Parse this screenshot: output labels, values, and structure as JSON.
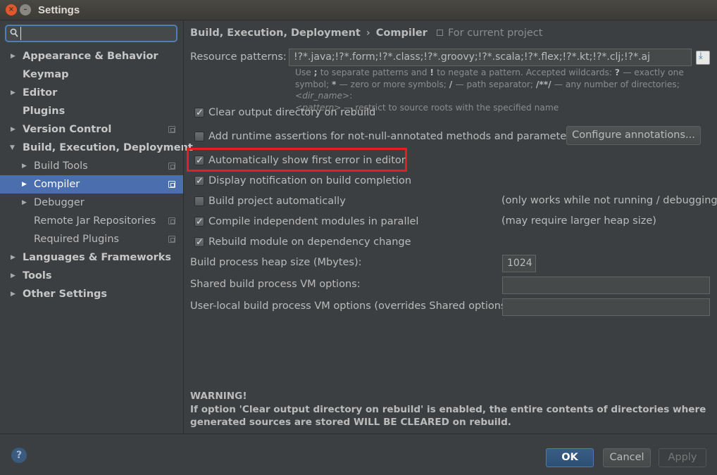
{
  "window": {
    "title": "Settings"
  },
  "search": {
    "value": "",
    "placeholder": ""
  },
  "sidebar": {
    "items": [
      {
        "label": "Appearance & Behavior",
        "arrow": "▶",
        "bold": true
      },
      {
        "label": "Keymap",
        "arrow": "",
        "bold": true
      },
      {
        "label": "Editor",
        "arrow": "▶",
        "bold": true
      },
      {
        "label": "Plugins",
        "arrow": "",
        "bold": true
      },
      {
        "label": "Version Control",
        "arrow": "▶",
        "bold": true
      },
      {
        "label": "Build, Execution, Deployment",
        "arrow": "▼",
        "bold": true
      },
      {
        "label": "Build Tools",
        "arrow": "▶",
        "bold": false
      },
      {
        "label": "Compiler",
        "arrow": "▶",
        "bold": false,
        "selected": true
      },
      {
        "label": "Debugger",
        "arrow": "▶",
        "bold": false
      },
      {
        "label": "Remote Jar Repositories",
        "arrow": "",
        "bold": false
      },
      {
        "label": "Required Plugins",
        "arrow": "",
        "bold": false
      },
      {
        "label": "Languages & Frameworks",
        "arrow": "▶",
        "bold": true
      },
      {
        "label": "Tools",
        "arrow": "▶",
        "bold": true
      },
      {
        "label": "Other Settings",
        "arrow": "▶",
        "bold": true
      }
    ]
  },
  "breadcrumb": {
    "parent": "Build, Execution, Deployment",
    "separator": "›",
    "current": "Compiler",
    "scope": "For current project"
  },
  "resource_patterns": {
    "label": "Resource patterns:",
    "value": "!?*.java;!?*.form;!?*.class;!?*.groovy;!?*.scala;!?*.flex;!?*.kt;!?*.clj;!?*.aj"
  },
  "hint": {
    "p1": "Use ",
    "p2": "; ",
    "p3": "to separate patterns and ",
    "p4": "! ",
    "p5": "to negate a pattern. Accepted wildcards: ",
    "p6": "? ",
    "p7": "— exactly one symbol; ",
    "p8": "* ",
    "p9": "— zero or more symbols; ",
    "p10": "/ ",
    "p11": "— path separator; ",
    "p12": "/**/ ",
    "p13": "— any number of directories; ",
    "p14": "<dir_name>",
    "p15": ":",
    "p16": "<pattern>",
    "p17": " — restrict to source roots with the specified name"
  },
  "checkboxes": [
    {
      "label": "Clear output directory on rebuild",
      "checked": true
    },
    {
      "label": "Add runtime assertions for not-null-annotated methods and parameters",
      "checked": false
    },
    {
      "label": "Automatically show first error in editor",
      "checked": true
    },
    {
      "label": "Display notification on build completion",
      "checked": true
    },
    {
      "label": "Build project automatically",
      "checked": false
    },
    {
      "label": "Compile independent modules in parallel",
      "checked": true
    },
    {
      "label": "Rebuild module on dependency change",
      "checked": true
    }
  ],
  "configure_annotations_label": "Configure annotations...",
  "notes": {
    "build_auto": "(only works while not running / debugging)",
    "parallel": "(may require larger heap size)"
  },
  "heap": {
    "label": "Build process heap size (Mbytes):",
    "value": "1024"
  },
  "shared_vm": {
    "label": "Shared build process VM options:",
    "value": ""
  },
  "user_vm": {
    "label": "User-local build process VM options (overrides Shared options):",
    "value": ""
  },
  "warning": {
    "title": "WARNING!",
    "line1": "If option 'Clear output directory on rebuild' is enabled, the entire contents of directories where",
    "line2": "generated sources are stored WILL BE CLEARED on rebuild."
  },
  "buttons": {
    "ok": "OK",
    "cancel": "Cancel",
    "apply": "Apply",
    "help": "?"
  },
  "colors": {
    "accent": "#4b6eaf",
    "highlight_border": "#e21f26",
    "background": "#3c3f41"
  }
}
